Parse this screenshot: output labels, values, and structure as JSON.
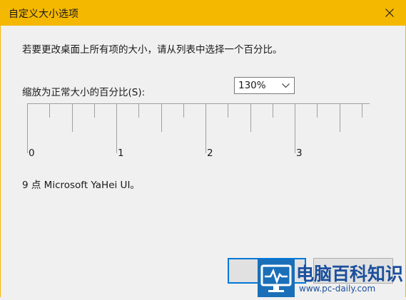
{
  "window": {
    "title": "自定义大小选项",
    "close_icon": "close-icon"
  },
  "dialog": {
    "intro": "若要更改桌面上所有项的大小，请从列表中选择一个百分比。",
    "scale_label": "缩放为正常大小的百分比(S):",
    "scale_select": {
      "selected": "130%"
    },
    "ruler_numbers": [
      "0",
      "1",
      "2",
      "3"
    ],
    "font_info": "9 点 Microsoft YaHei UI。"
  },
  "buttons": {
    "ok_label": "",
    "cancel_label": ""
  },
  "watermark": {
    "text": "电脑百科知识",
    "url": "www.pc-daily.com",
    "icon": "monitor-pulse-icon"
  },
  "colors": {
    "titlebar": "#f5b800",
    "focus_border": "#0078d7",
    "watermark": "#1b4f9c"
  }
}
